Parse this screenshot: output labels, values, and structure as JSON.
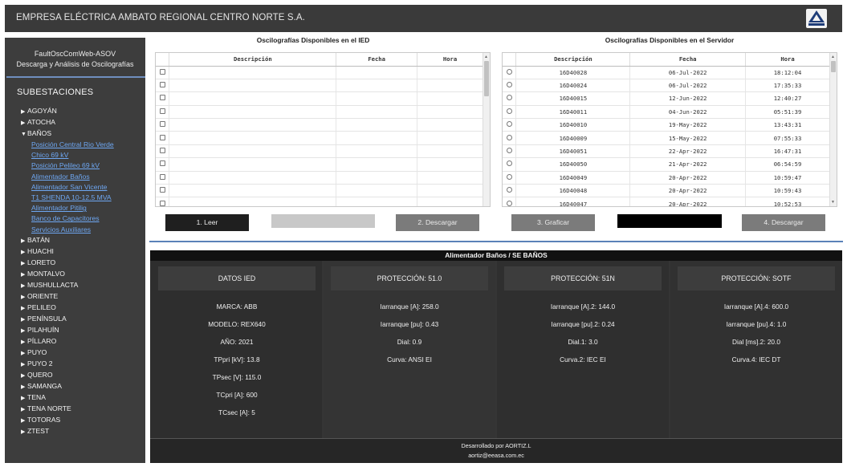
{
  "header": {
    "company": "EMPRESA ELÉCTRICA AMBATO REGIONAL CENTRO NORTE S.A."
  },
  "sidebar": {
    "app_name": "FaultOscComWeb-ASOV",
    "app_desc": "Descarga y Análisis de Oscilografías",
    "section": "SUBESTACIONES",
    "before": [
      "AGOYÁN",
      "ATOCHA"
    ],
    "expanded": "BAÑOS",
    "baños_items": [
      "Posición Central Rio Verde Chico 69 kV",
      "Posición Pelileo 69 kV",
      "Alimentador Baños",
      "Alimentador San Vicente",
      "T1 SHENDA 10-12.5 MVA",
      "Alimentador Pitilig",
      "Banco de Capacitores",
      "Servicios Auxiliares"
    ],
    "after": [
      "BATÁN",
      "HUACHI",
      "LORETO",
      "MONTALVO",
      "MUSHULLACTA",
      "ORIENTE",
      "PELILEO",
      "PENÍNSULA",
      "PILAHUÍN",
      "PÍLLARO",
      "PUYO",
      "PUYO 2",
      "QUERO",
      "SAMANGA",
      "TENA",
      "TENA NORTE",
      "TOTORAS",
      "ZTEST"
    ]
  },
  "ied_table": {
    "title": "Oscilografías Disponibles en el IED",
    "headers": [
      "Descripción",
      "Fecha",
      "Hora"
    ],
    "row_count": 11
  },
  "server_table": {
    "title": "Oscilografías Disponibles en el Servidor",
    "headers": [
      "Descripción",
      "Fecha",
      "Hora"
    ],
    "rows": [
      [
        "16D40028",
        "06-Jul-2022",
        "18:12:04"
      ],
      [
        "16D40024",
        "06-Jul-2022",
        "17:35:33"
      ],
      [
        "16D40015",
        "12-Jun-2022",
        "12:40:27"
      ],
      [
        "16D40011",
        "04-Jun-2022",
        "05:51:39"
      ],
      [
        "16D40010",
        "19-May-2022",
        "13:43:31"
      ],
      [
        "16D40009",
        "15-May-2022",
        "07:55:33"
      ],
      [
        "16D40051",
        "22-Apr-2022",
        "16:47:31"
      ],
      [
        "16D40050",
        "21-Apr-2022",
        "06:54:59"
      ],
      [
        "16D40049",
        "20-Apr-2022",
        "10:59:47"
      ],
      [
        "16D40048",
        "20-Apr-2022",
        "10:59:43"
      ],
      [
        "16D40047",
        "20-Apr-2022",
        "10:52:53"
      ]
    ]
  },
  "buttons": {
    "read": "1. Leer",
    "download": "2. Descargar",
    "plot": "3. Graficar",
    "download2": "4. Descargar"
  },
  "panel": {
    "title": "Alimentador Baños / SE BAÑOS",
    "ied": {
      "head": "DATOS IED",
      "lines": [
        "MARCA: ABB",
        "MODELO: REX640",
        "AÑO: 2021",
        "TPpri [kV]: 13.8",
        "TPsec [V]: 115.0",
        "TCpri [A]: 600",
        "TCsec [A]: 5"
      ]
    },
    "p51": {
      "head": "PROTECCIÓN: 51.0",
      "lines": [
        "Iarranque [A]: 258.0",
        "Iarranque [pu]: 0.43",
        "Dial: 0.9",
        "Curva: ANSI EI"
      ]
    },
    "p51n": {
      "head": "PROTECCIÓN: 51N",
      "lines": [
        "Iarranque [A].2: 144.0",
        "Iarranque [pu].2: 0.24",
        "Dial.1: 3.0",
        "Curva.2: IEC EI"
      ]
    },
    "psotf": {
      "head": "PROTECCIÓN: SOTF",
      "lines": [
        "Iarranque [A].4: 600.0",
        "Iarranque [pu].4: 1.0",
        "Dial [ms].2: 20.0",
        "Curva.4: IEC DT"
      ]
    },
    "footer_line1": "Desarrollado por AORTIZ.L",
    "footer_line2": "aortiz@eeasa.com.ec"
  },
  "colors": {
    "topbar": "#3a3a3a",
    "sidebar": "#3d3d3d",
    "link": "#6ea7f2",
    "accent": "#5b82b8",
    "panel": "#353535"
  }
}
